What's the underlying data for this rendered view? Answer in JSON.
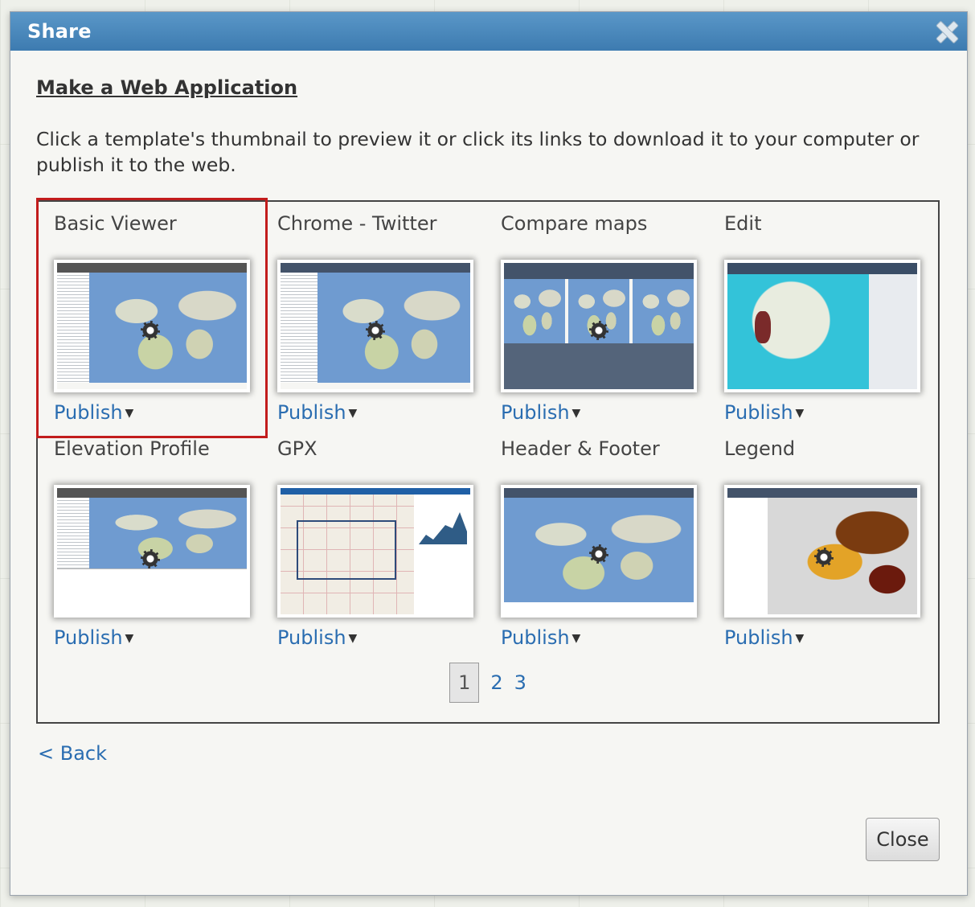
{
  "dialog": {
    "title": "Share",
    "heading": "Make a Web Application",
    "instructions": "Click a template's thumbnail to preview it or click its links to download it to your computer or publish it to the web.",
    "templates": [
      {
        "name": "Basic Viewer",
        "publish": "Publish",
        "selected": true
      },
      {
        "name": "Chrome - Twitter",
        "publish": "Publish"
      },
      {
        "name": "Compare maps",
        "publish": "Publish"
      },
      {
        "name": "Edit",
        "publish": "Publish"
      },
      {
        "name": "Elevation Profile",
        "publish": "Publish"
      },
      {
        "name": "GPX",
        "publish": "Publish"
      },
      {
        "name": "Header & Footer",
        "publish": "Publish"
      },
      {
        "name": "Legend",
        "publish": "Publish"
      }
    ],
    "pagination": {
      "pages": [
        "1",
        "2",
        "3"
      ],
      "current": "1"
    },
    "back_label": "< Back",
    "close_label": "Close",
    "colors": {
      "titlebar": "#4a88bd",
      "link": "#2a6db1",
      "selection": "#c21c1c"
    }
  }
}
